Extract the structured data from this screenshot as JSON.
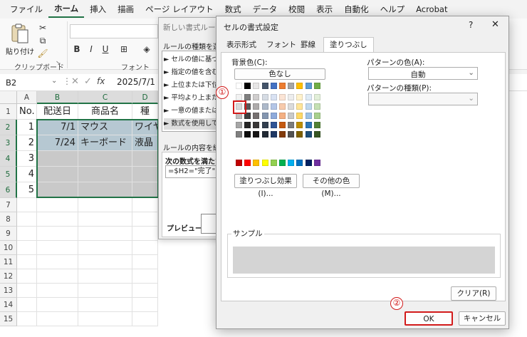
{
  "menu": [
    "ファイル",
    "ホーム",
    "挿入",
    "描画",
    "ページ レイアウト",
    "数式",
    "データ",
    "校閲",
    "表示",
    "自動化",
    "ヘルプ",
    "Acrobat"
  ],
  "ribbon": {
    "paste_label": "貼り付け",
    "clipboard_label": "クリップボード",
    "font_label": "フォント"
  },
  "formula": {
    "name_box": "B2",
    "content": "2025/7/1"
  },
  "columns": [
    "A",
    "B",
    "C",
    "D"
  ],
  "rows": [
    "1",
    "2",
    "3",
    "4",
    "5",
    "6",
    "7",
    "8",
    "9",
    "10",
    "11",
    "12",
    "13",
    "14",
    "15"
  ],
  "table": {
    "header": [
      "No.",
      "配送日",
      "商品名",
      "種"
    ],
    "rows": [
      [
        "1",
        "7/1",
        "マウス",
        "ワイヤ"
      ],
      [
        "2",
        "7/24",
        "キーボード",
        "液晶"
      ],
      [
        "3",
        "",
        "",
        ""
      ],
      [
        "4",
        "",
        "",
        ""
      ],
      [
        "5",
        "",
        "",
        ""
      ]
    ]
  },
  "new_rule": {
    "title": "新しい書式ルール",
    "select_label": "ルールの種類を選択し",
    "rule_types": [
      "► セルの値に基づい",
      "► 指定の値を含むセ",
      "► 上位または下位に",
      "► 平均より上または",
      "► 一意の値または重",
      "► 数式を使用して、"
    ],
    "edit_label": "ルールの内容を編集し",
    "formula_label": "次の数式を満たす場",
    "formula_value": "=$H2=\"完了\"",
    "preview_label": "プレビュー:"
  },
  "format_cells": {
    "title": "セルの書式設定",
    "help": "?",
    "close": "✕",
    "tabs": [
      "表示形式",
      "フォント",
      "罫線",
      "塗りつぶし"
    ],
    "bg_label": "背景色(C):",
    "no_color": "色なし",
    "pattern_color_label": "パターンの色(A):",
    "pattern_color_value": "自動",
    "pattern_type_label": "パターンの種類(P):",
    "pattern_type_value": "",
    "fill_effects": "塗りつぶし効果(I)...",
    "more_colors": "その他の色(M)...",
    "sample_label": "サンプル",
    "clear": "クリア(R)",
    "ok": "OK",
    "cancel": "キャンセル"
  },
  "annotations": {
    "step1": "①",
    "step2": "②"
  },
  "colors": {
    "accent": "#217346",
    "highlight_red": "#d21a1a",
    "selected_fill": "#c9c9c9",
    "row2_fill": "#b6c8d2",
    "sample_fill": "#d4d4d4",
    "palette_row1": [
      "#ffffff",
      "#000000",
      "#e7e6e6",
      "#44546a",
      "#4472c4",
      "#ed7d31",
      "#a5a5a5",
      "#ffc000",
      "#5b9bd5",
      "#70ad47"
    ],
    "palette_rows": [
      [
        "#f2f2f2",
        "#7f7f7f",
        "#d0cece",
        "#d6dce4",
        "#d9e2f3",
        "#fbe4d5",
        "#ededed",
        "#fff2cc",
        "#deebf6",
        "#e2efd9"
      ],
      [
        "#d9d9d9",
        "#595959",
        "#aeabab",
        "#adb9ca",
        "#b4c6e7",
        "#f7caac",
        "#dbdbdb",
        "#ffe598",
        "#bdd7ee",
        "#c5e0b3"
      ],
      [
        "#bfbfbf",
        "#3f3f3f",
        "#757070",
        "#8496b0",
        "#8eaadb",
        "#f4b083",
        "#c9c9c9",
        "#ffd965",
        "#9cc2e5",
        "#a8d08d"
      ],
      [
        "#a6a6a6",
        "#262626",
        "#3a3838",
        "#323f4f",
        "#2f5496",
        "#c45911",
        "#7b7b7b",
        "#bf8f00",
        "#2e75b5",
        "#538135"
      ],
      [
        "#7f7f7f",
        "#0d0d0d",
        "#171616",
        "#222a35",
        "#1f3864",
        "#823b0b",
        "#525252",
        "#7f6000",
        "#1e4e79",
        "#375623"
      ]
    ],
    "palette_standard": [
      "#c00000",
      "#ff0000",
      "#ffc000",
      "#ffff00",
      "#92d050",
      "#00b050",
      "#00b0f0",
      "#0070c0",
      "#002060",
      "#7030a0"
    ]
  }
}
